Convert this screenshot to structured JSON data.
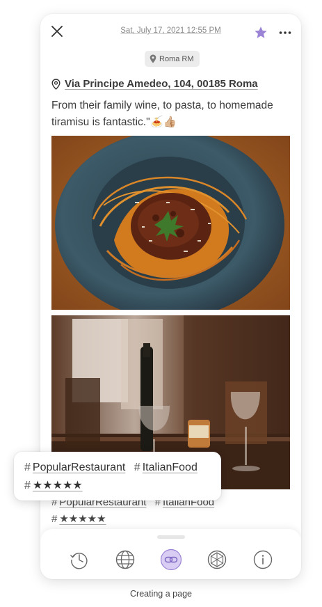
{
  "entry": {
    "datetime": "Sat, July 17, 2021 12:55 PM",
    "location_chip": "Roma RM",
    "address": "Via Principe Amedeo, 104, 00185 Roma",
    "body": "From their family wine, to pasta, to homemade tiramisu is fantastic.\"🍝👍🏼",
    "starred": true,
    "photos": [
      {
        "subject": "spaghetti bolognese in blue bowl"
      },
      {
        "subject": "wine bottle and glasses in restaurant"
      }
    ]
  },
  "tags": {
    "hash_symbol": "#",
    "items": [
      "PopularRestaurant",
      "ItalianFood",
      "★★★★★"
    ]
  },
  "bottom_nav": {
    "items": [
      {
        "name": "history-icon"
      },
      {
        "name": "globe-icon"
      },
      {
        "name": "link-icon",
        "active": true
      },
      {
        "name": "weather-icon"
      },
      {
        "name": "info-icon"
      }
    ]
  },
  "caption": "Creating a page",
  "colors": {
    "accent_purple": "#9b83d6",
    "active_icon_bg": "#d9cdf3",
    "text_dark": "#333333",
    "muted": "#8a8a8a",
    "chip_bg": "#ececec"
  }
}
